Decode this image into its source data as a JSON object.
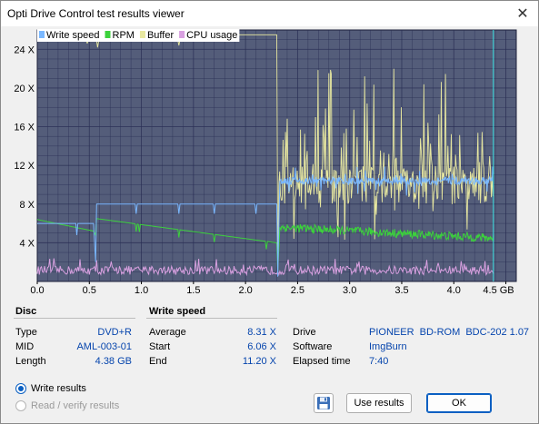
{
  "window": {
    "title": "Opti Drive Control test results viewer"
  },
  "chart_data": {
    "type": "line",
    "legend": [
      "Write speed",
      "RPM",
      "Buffer",
      "CPU usage"
    ],
    "colors": {
      "write_speed": "#7ab8ff",
      "rpm": "#3cd23c",
      "buffer": "#e8e8a0",
      "cpu": "#d8a0e0",
      "plot_bg": "#545d7a",
      "grid": "#2a2f55"
    },
    "x_ticks": [
      "0.0",
      "0.5",
      "1.0",
      "1.5",
      "2.0",
      "2.5",
      "3.0",
      "3.5",
      "4.0",
      "4.5 GB"
    ],
    "y_ticks": [
      "4 X",
      "8 X",
      "12 X",
      "16 X",
      "20 X",
      "24 X"
    ],
    "xlim": [
      0,
      4.6
    ],
    "ylim": [
      0,
      26
    ],
    "end_marker_x": 4.38,
    "write_speed": [
      [
        0.0,
        6.0
      ],
      [
        0.55,
        6.0
      ],
      [
        0.56,
        2.0
      ],
      [
        0.57,
        8.0
      ],
      [
        2.3,
        8.0
      ],
      [
        2.31,
        0.5
      ],
      [
        2.33,
        10.4
      ],
      [
        2.8,
        10.4
      ],
      [
        3.5,
        10.6
      ],
      [
        4.0,
        10.4
      ],
      [
        4.38,
        10.2
      ]
    ],
    "rpm": [
      [
        0.0,
        6.4
      ],
      [
        0.55,
        5.2
      ],
      [
        0.57,
        6.5
      ],
      [
        1.0,
        5.7
      ],
      [
        1.5,
        4.9
      ],
      [
        2.0,
        4.3
      ],
      [
        2.3,
        4.0
      ],
      [
        2.33,
        5.6
      ],
      [
        3.0,
        5.2
      ],
      [
        3.5,
        4.9
      ],
      [
        4.0,
        4.6
      ],
      [
        4.38,
        4.4
      ]
    ],
    "buffer": [
      [
        0.0,
        25.6
      ],
      [
        0.5,
        25.5
      ],
      [
        2.3,
        25.5
      ],
      [
        2.31,
        1.0
      ],
      [
        4.38,
        7.0
      ]
    ],
    "cpu": [
      [
        0.0,
        1.0
      ],
      [
        4.38,
        1.0
      ]
    ]
  },
  "disc": {
    "title": "Disc",
    "rows": [
      {
        "label": "Type",
        "value": "DVD+R"
      },
      {
        "label": "MID",
        "value": "AML-003-01"
      },
      {
        "label": "Length",
        "value": "4.38 GB"
      }
    ]
  },
  "write_speed": {
    "title": "Write speed",
    "rows": [
      {
        "label": "Average",
        "value": "8.31 X"
      },
      {
        "label": "Start",
        "value": "6.06 X"
      },
      {
        "label": "End",
        "value": "11.20 X"
      }
    ]
  },
  "drive_info": {
    "rows": [
      {
        "label": "Drive",
        "value": "PIONEER  BD-ROM  BDC-202 1.07"
      },
      {
        "label": "Software",
        "value": "ImgBurn"
      },
      {
        "label": "Elapsed time",
        "value": "7:40"
      }
    ]
  },
  "options": {
    "write_results": "Write results",
    "read_verify_results": "Read / verify results"
  },
  "buttons": {
    "use_results": "Use results",
    "ok": "OK"
  }
}
